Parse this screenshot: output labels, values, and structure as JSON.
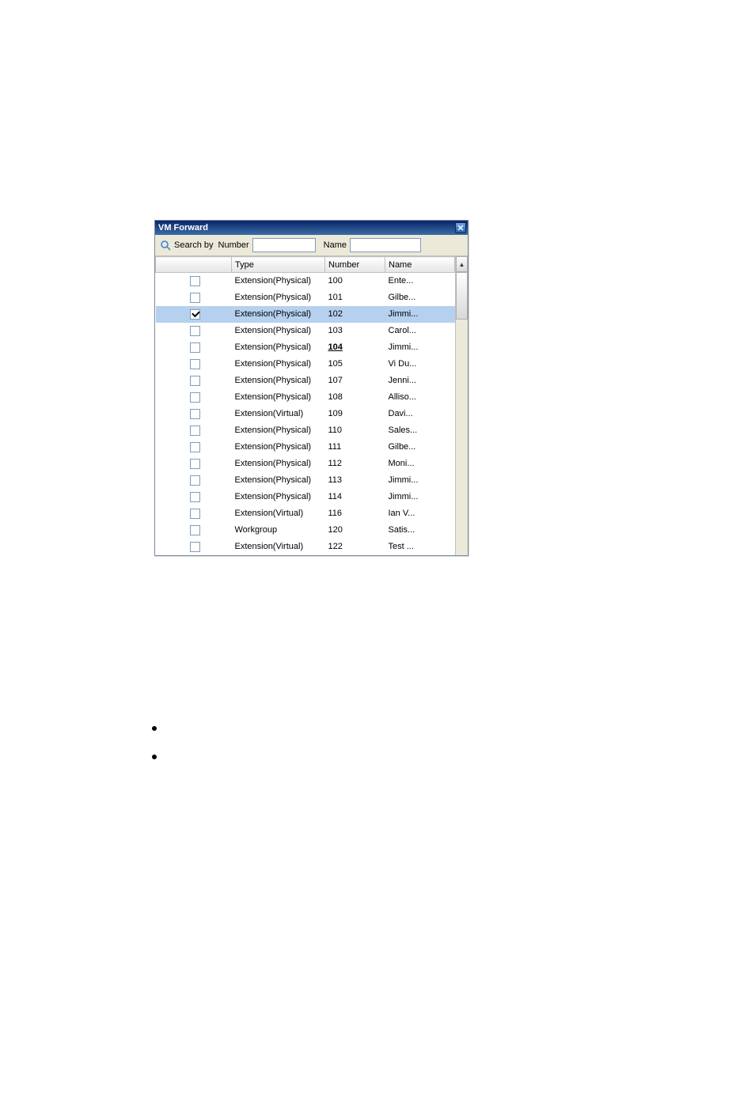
{
  "window": {
    "title": "VM Forward",
    "close_icon": "close-icon"
  },
  "search": {
    "label": "Search by",
    "number_label": "Number",
    "name_label": "Name",
    "number_value": "",
    "name_value": ""
  },
  "columns": {
    "check": "",
    "type": "Type",
    "number": "Number",
    "name": "Name"
  },
  "rows": [
    {
      "checked": false,
      "selected": false,
      "type": "Extension(Physical)",
      "number": "100",
      "number_emph": false,
      "name": "Ente..."
    },
    {
      "checked": false,
      "selected": false,
      "type": "Extension(Physical)",
      "number": "101",
      "number_emph": false,
      "name": "Gilbe..."
    },
    {
      "checked": true,
      "selected": true,
      "type": "Extension(Physical)",
      "number": "102",
      "number_emph": false,
      "name": "Jimmi..."
    },
    {
      "checked": false,
      "selected": false,
      "type": "Extension(Physical)",
      "number": "103",
      "number_emph": false,
      "name": "Carol..."
    },
    {
      "checked": false,
      "selected": false,
      "type": "Extension(Physical)",
      "number": "104",
      "number_emph": true,
      "name": "Jimmi..."
    },
    {
      "checked": false,
      "selected": false,
      "type": "Extension(Physical)",
      "number": "105",
      "number_emph": false,
      "name": "Vi Du..."
    },
    {
      "checked": false,
      "selected": false,
      "type": "Extension(Physical)",
      "number": "107",
      "number_emph": false,
      "name": "Jenni..."
    },
    {
      "checked": false,
      "selected": false,
      "type": "Extension(Physical)",
      "number": "108",
      "number_emph": false,
      "name": "Alliso..."
    },
    {
      "checked": false,
      "selected": false,
      "type": "Extension(Virtual)",
      "number": "109",
      "number_emph": false,
      "name": "Davi..."
    },
    {
      "checked": false,
      "selected": false,
      "type": "Extension(Physical)",
      "number": "110",
      "number_emph": false,
      "name": "Sales..."
    },
    {
      "checked": false,
      "selected": false,
      "type": "Extension(Physical)",
      "number": "111",
      "number_emph": false,
      "name": "Gilbe..."
    },
    {
      "checked": false,
      "selected": false,
      "type": "Extension(Physical)",
      "number": "112",
      "number_emph": false,
      "name": "Moni..."
    },
    {
      "checked": false,
      "selected": false,
      "type": "Extension(Physical)",
      "number": "113",
      "number_emph": false,
      "name": "Jimmi..."
    },
    {
      "checked": false,
      "selected": false,
      "type": "Extension(Physical)",
      "number": "114",
      "number_emph": false,
      "name": "Jimmi..."
    },
    {
      "checked": false,
      "selected": false,
      "type": "Extension(Virtual)",
      "number": "116",
      "number_emph": false,
      "name": "Ian V..."
    },
    {
      "checked": false,
      "selected": false,
      "type": "Workgroup",
      "number": "120",
      "number_emph": false,
      "name": "Satis..."
    },
    {
      "checked": false,
      "selected": false,
      "type": "Extension(Virtual)",
      "number": "122",
      "number_emph": false,
      "name": "Test ..."
    }
  ]
}
